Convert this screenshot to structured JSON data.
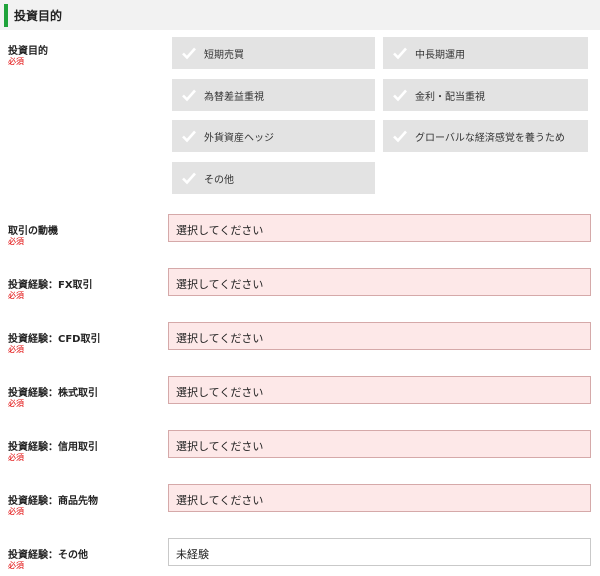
{
  "section": {
    "title": "投資目的"
  },
  "purpose": {
    "label": "投資目的",
    "required": "必須",
    "options": [
      "短期売買",
      "中長期運用",
      "為替差益重視",
      "金利・配当重視",
      "外貨資産ヘッジ",
      "グローバルな経済感覚を養うため",
      "その他"
    ]
  },
  "fields": [
    {
      "label": "取引の動機",
      "required": "必須",
      "value": "選択してください"
    },
    {
      "label": "投資経験：FX取引",
      "required": "必須",
      "value": "選択してください"
    },
    {
      "label": "投資経験：CFD取引",
      "required": "必須",
      "value": "選択してください"
    },
    {
      "label": "投資経験：株式取引",
      "required": "必須",
      "value": "選択してください"
    },
    {
      "label": "投資経験：信用取引",
      "required": "必須",
      "value": "選択してください"
    },
    {
      "label": "投資経験：商品先物",
      "required": "必須",
      "value": "選択してください"
    },
    {
      "label": "投資経験：その他",
      "required": "必須",
      "value": "未経験"
    }
  ],
  "colors": {
    "accent": "#1fa33a",
    "required": "#e00000",
    "unselected_field": "#fde8e8",
    "checkbox_bg": "#e3e3e3"
  }
}
